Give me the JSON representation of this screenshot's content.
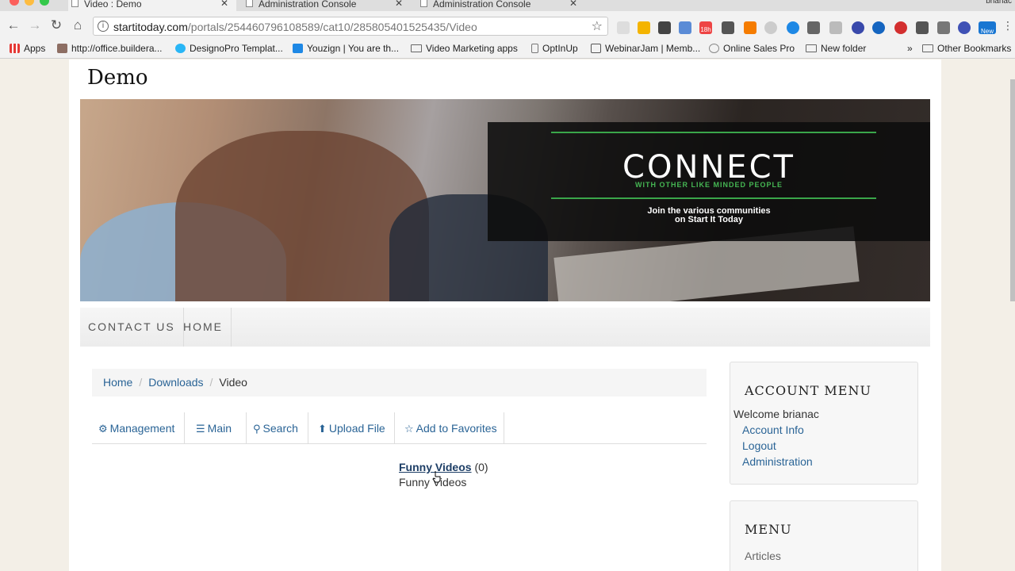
{
  "browser": {
    "tabs": [
      {
        "title": "Video : Demo",
        "active": true
      },
      {
        "title": "Administration Console",
        "active": false
      },
      {
        "title": "Administration Console",
        "active": false
      }
    ],
    "user": "brianac",
    "url_host": "startitoday.com",
    "url_path": "/portals/254460796108589/cat10/285805401525435/Video",
    "bookmarks": [
      "Apps",
      "http://office.buildera...",
      "DesignoPro Templat...",
      "Youzign | You are th...",
      "Video Marketing apps",
      "OptInUp",
      "WebinarJam | Memb...",
      "Online Sales Pro",
      "New folder",
      "Other Bookmarks"
    ],
    "ext_badge": "18h",
    "ext_new": "New"
  },
  "site": {
    "title": "Demo",
    "banner": {
      "headline": "CONNECT",
      "tagline": "WITH OTHER LIKE MINDED PEOPLE",
      "subline1": "Join the various communities",
      "subline2": "on Start It Today"
    },
    "nav": [
      "CONTACT US",
      "HOME"
    ],
    "breadcrumb": [
      "Home",
      "Downloads",
      "Video"
    ],
    "actions": [
      {
        "icon": "gear-icon",
        "label": "Management"
      },
      {
        "icon": "list-icon",
        "label": "Main"
      },
      {
        "icon": "search-icon",
        "label": "Search"
      },
      {
        "icon": "upload-icon",
        "label": "Upload File"
      },
      {
        "icon": "star-icon",
        "label": "Add to Favorites"
      }
    ],
    "category": {
      "name": "Funny Videos",
      "count": "(0)",
      "description": "Funny Videos"
    },
    "account_menu": {
      "title": "ACCOUNT MENU",
      "welcome": "Welcome brianac",
      "links": [
        "Account Info",
        "Logout",
        "Administration"
      ]
    },
    "menu": {
      "title": "MENU",
      "items": [
        "Articles"
      ]
    }
  },
  "colors": {
    "link": "#2a6496",
    "accent_green": "#3aa64a"
  }
}
